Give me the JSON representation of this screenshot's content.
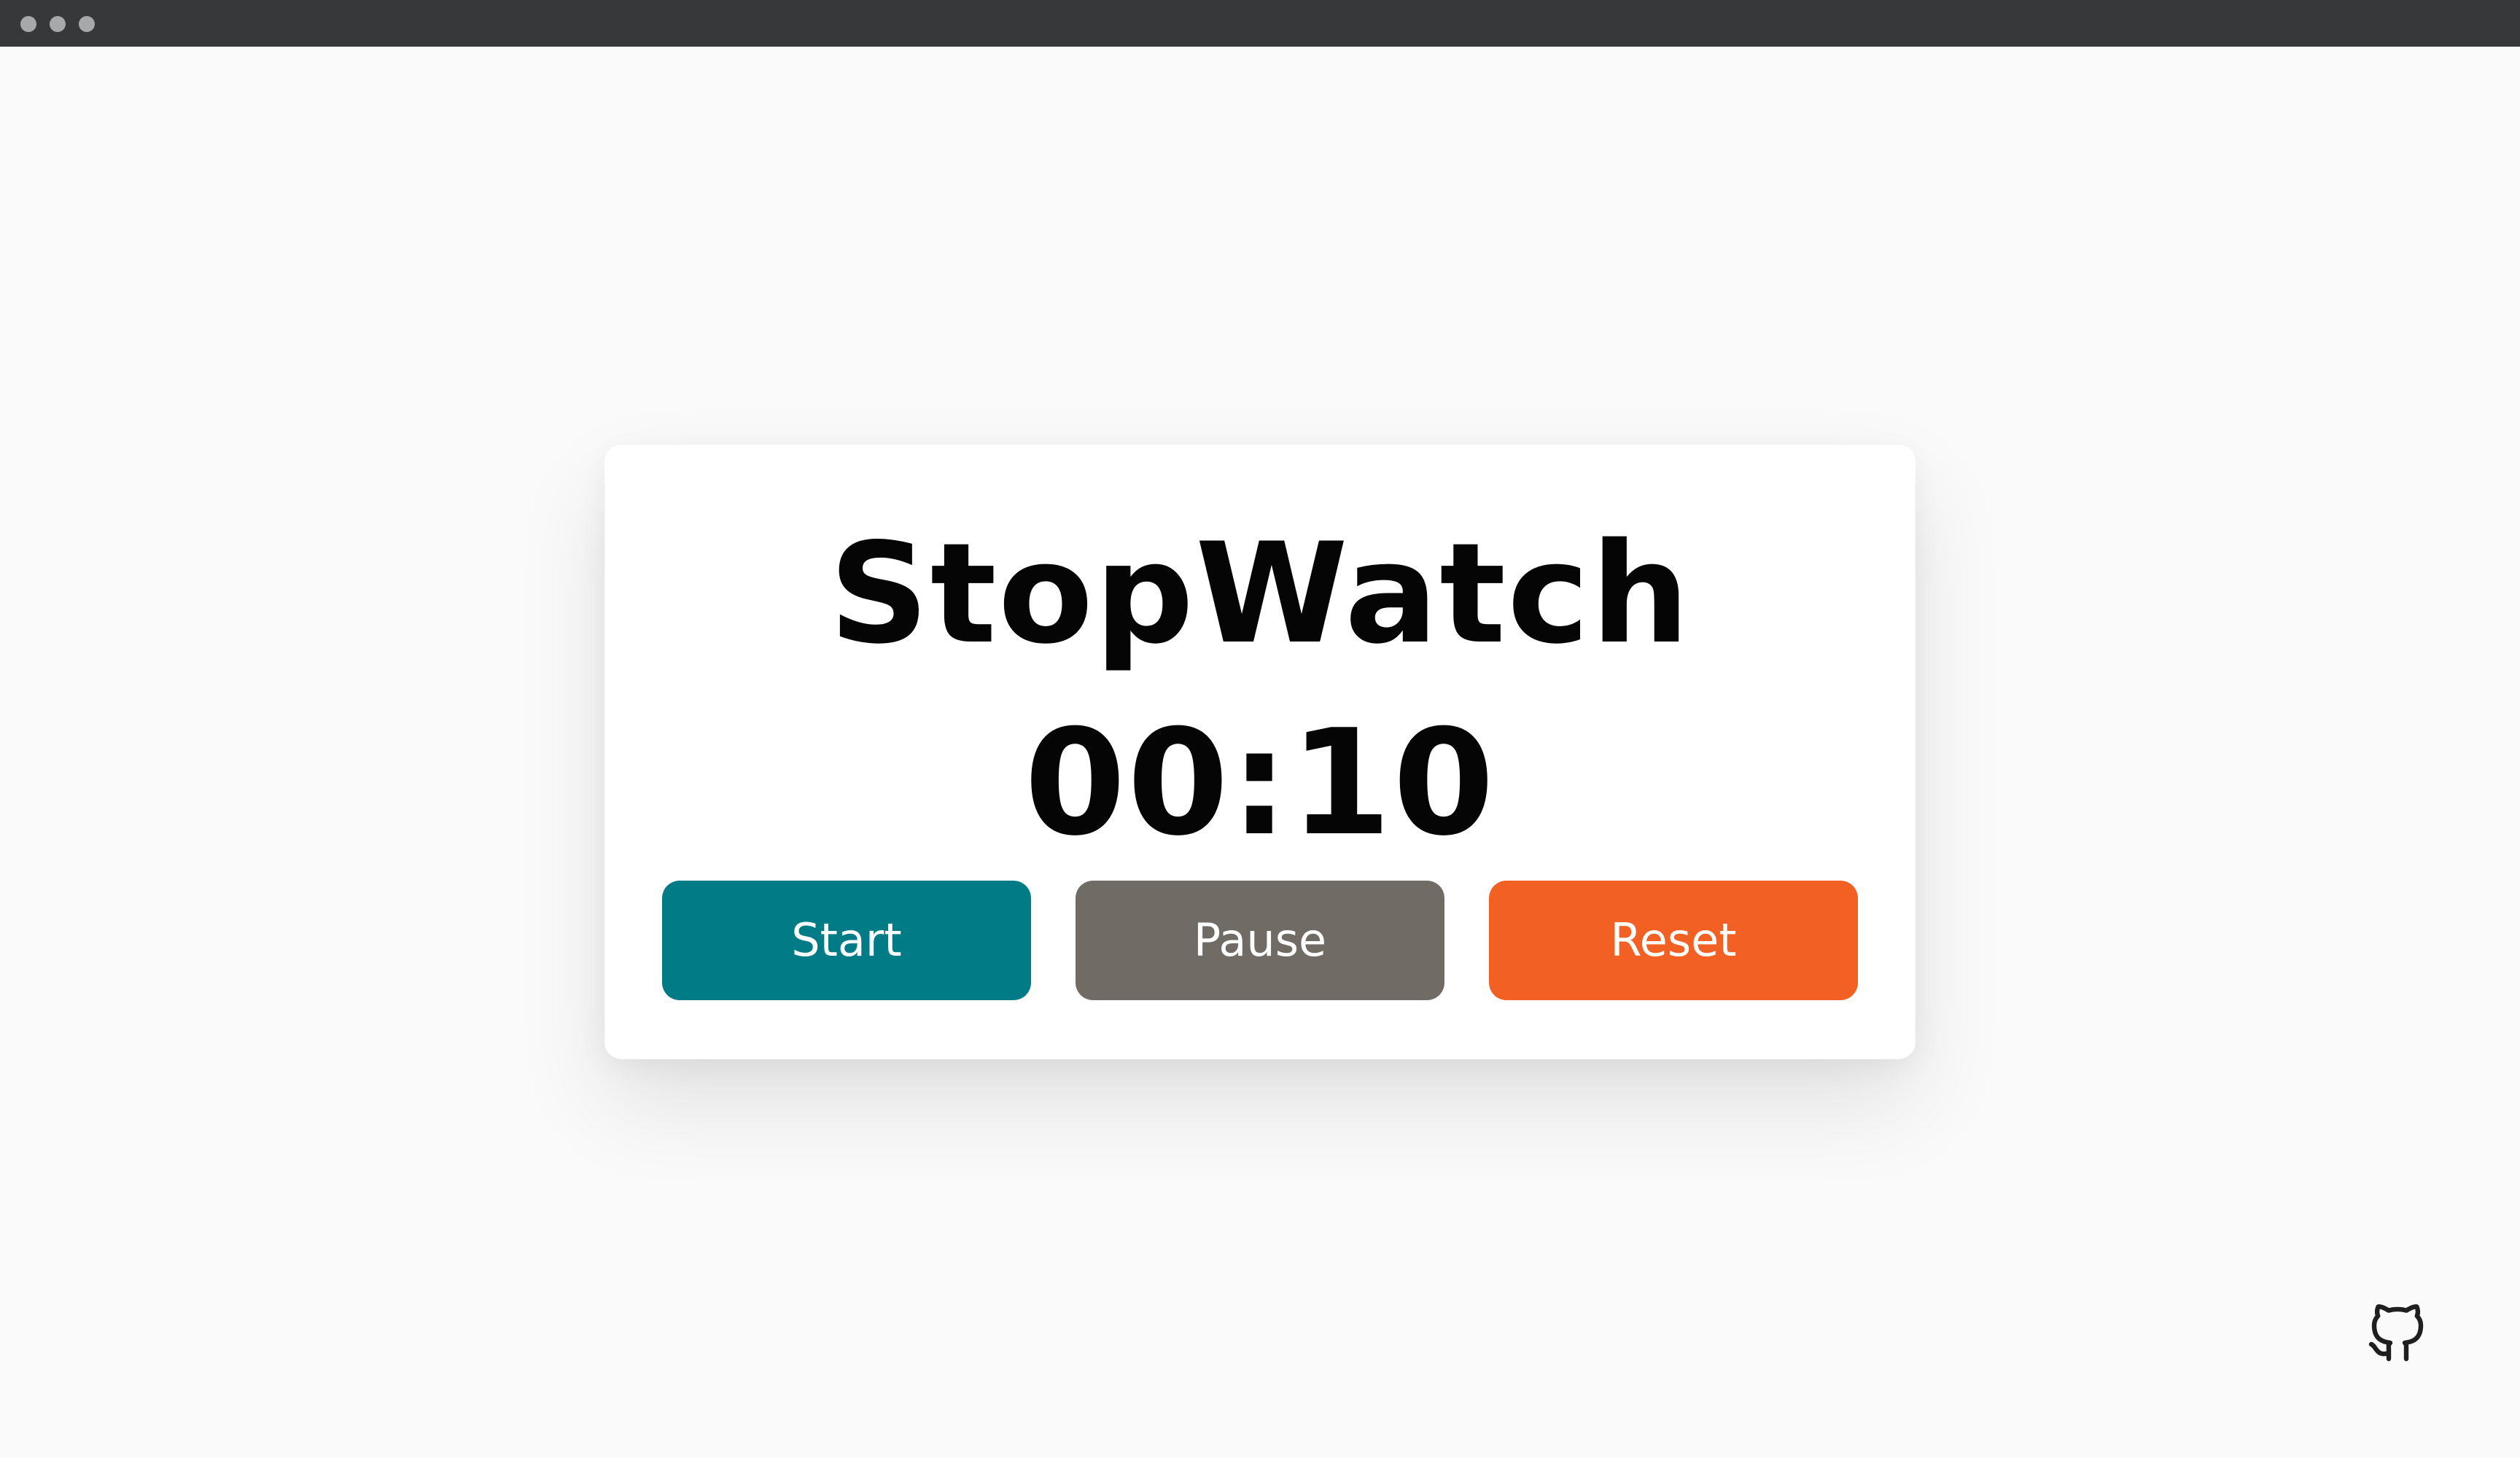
{
  "window": {
    "traffic_lights": [
      "close",
      "minimize",
      "zoom"
    ]
  },
  "stopwatch": {
    "title": "StopWatch",
    "time": "00:10"
  },
  "buttons": {
    "start_label": "Start",
    "pause_label": "Pause",
    "reset_label": "Reset"
  },
  "colors": {
    "start": "#017b85",
    "pause": "#706b64",
    "reset": "#f26024",
    "background": "#fafafa",
    "titlebar": "#37383a"
  },
  "icons": {
    "footer_link": "github-icon"
  }
}
